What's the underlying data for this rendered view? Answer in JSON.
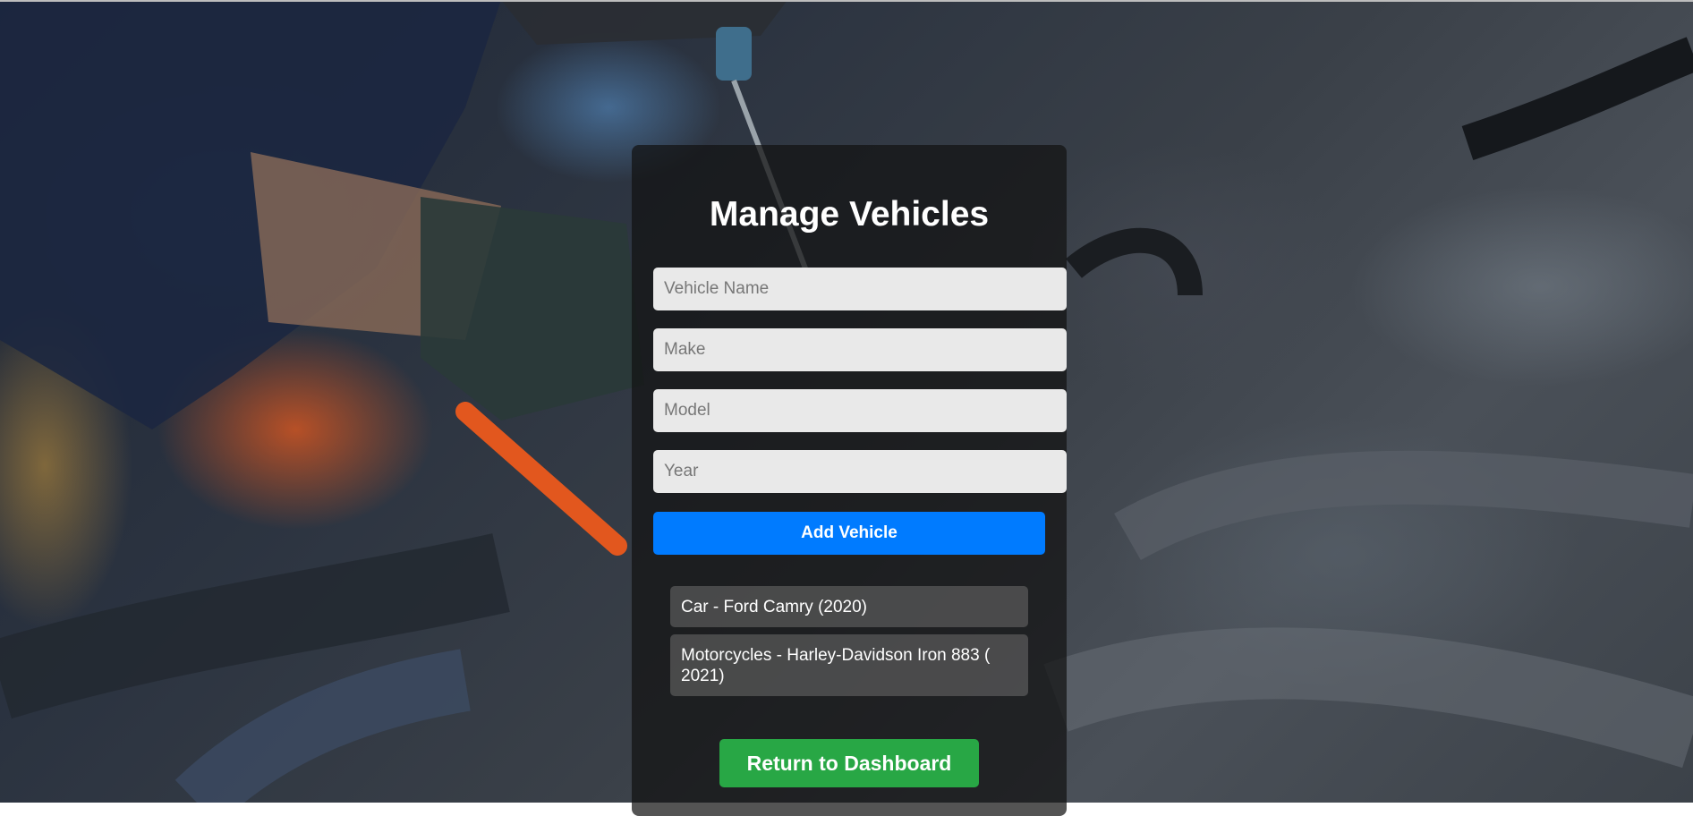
{
  "page": {
    "title": "Manage Vehicles"
  },
  "form": {
    "vehicle_name": {
      "placeholder": "Vehicle Name",
      "value": ""
    },
    "make": {
      "placeholder": "Make",
      "value": ""
    },
    "model": {
      "placeholder": "Model",
      "value": ""
    },
    "year": {
      "placeholder": "Year",
      "value": ""
    },
    "add_label": "Add Vehicle"
  },
  "vehicles": [
    {
      "label": "Car - Ford Camry (2020)"
    },
    {
      "label": "Motorcycles - Harley-Davidson Iron 883 ( 2021)"
    }
  ],
  "footer": {
    "return_label": "Return to Dashboard"
  },
  "colors": {
    "primary": "#007bff",
    "success": "#28a745",
    "panel": "#121212",
    "input_bg": "#e9e9e9"
  }
}
